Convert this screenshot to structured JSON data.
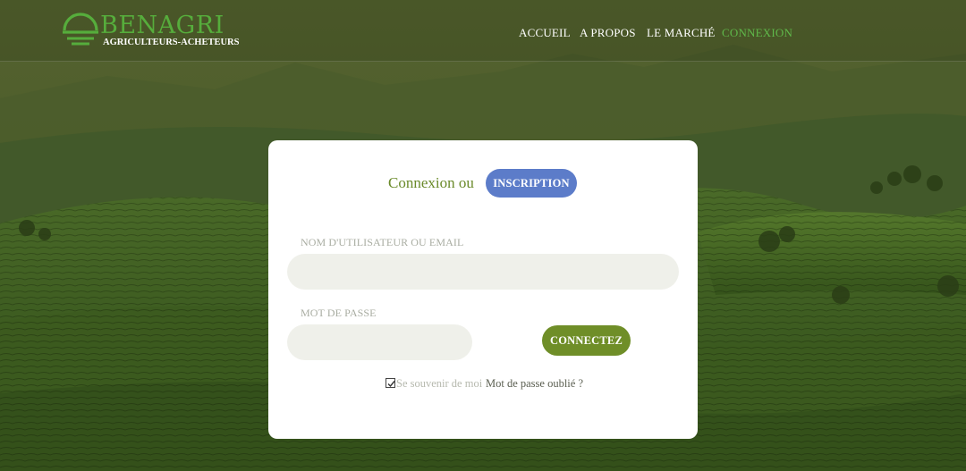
{
  "brand": {
    "name": "BENAGRI",
    "tagline": "AGRICULTEURS-ACHETEURS",
    "accent": "#56ad3c"
  },
  "nav": {
    "items": [
      {
        "label": "ACCUEIL",
        "active": false
      },
      {
        "label": "A PROPOS",
        "active": false
      },
      {
        "label": "LE MARCHÉ",
        "active": false
      },
      {
        "label": "CONNEXION",
        "active": true
      }
    ]
  },
  "login": {
    "title": "Connexion ou",
    "signup_label": "INSCRIPTION",
    "username_label": "NOM D'UTILISATEUR OU EMAIL",
    "username_value": "",
    "password_label": "MOT DE PASSE",
    "password_value": "",
    "submit_label": "CONNECTEZ",
    "remember_label": "Se souvenir de moi",
    "remember_checked": true,
    "forgot_label": "Mot de passe oublié ?"
  },
  "colors": {
    "signup_button": "#5c7cc9",
    "submit_button": "#6f8e28",
    "title_text": "#6a8a2a",
    "input_background": "#eff0ea"
  },
  "icons": {
    "logo": "sun-horizon-logo-icon",
    "checkbox": "checkmark-icon"
  }
}
